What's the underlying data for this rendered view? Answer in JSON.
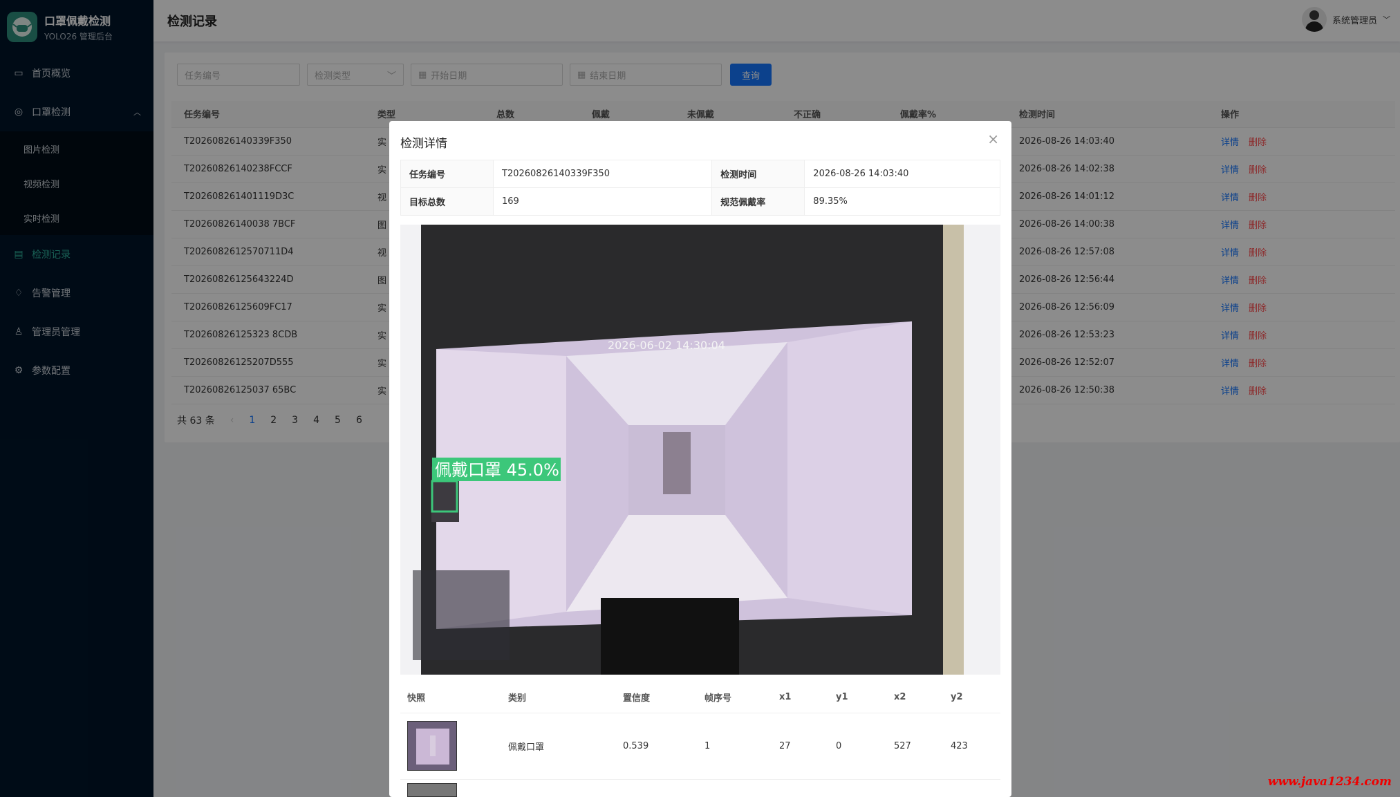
{
  "app": {
    "title": "口罩佩戴检测",
    "subtitle": "YOLO26 管理后台"
  },
  "sidebar": {
    "items": [
      {
        "label": "首页概览",
        "icon": "monitor-icon"
      },
      {
        "label": "口罩检测",
        "icon": "camera-icon"
      },
      {
        "label": "检测记录",
        "icon": "document-icon"
      },
      {
        "label": "告警管理",
        "icon": "bell-icon"
      },
      {
        "label": "管理员管理",
        "icon": "user-icon"
      },
      {
        "label": "参数配置",
        "icon": "gear-icon"
      }
    ],
    "sub_items": [
      "图片检测",
      "视频检测",
      "实时检测"
    ]
  },
  "header": {
    "title": "检测记录",
    "user": "系统管理员"
  },
  "filters": {
    "task_placeholder": "任务编号",
    "type_placeholder": "检测类型",
    "start_placeholder": "开始日期",
    "end_placeholder": "结束日期",
    "query": "查询"
  },
  "table": {
    "headers": [
      "任务编号",
      "类型",
      "总数",
      "佩戴",
      "未佩戴",
      "不正确",
      "佩戴率%",
      "检测时间",
      "操作"
    ],
    "detail": "详情",
    "delete": "删除",
    "rows": [
      {
        "id": "T20260826140339F350",
        "type": "实",
        "time": "2026-08-26 14:03:40"
      },
      {
        "id": "T20260826140238FCCF",
        "type": "实",
        "time": "2026-08-26 14:02:38"
      },
      {
        "id": "T202608261401119D3C",
        "type": "视",
        "time": "2026-08-26 14:01:12"
      },
      {
        "id": "T20260826140038 7BCF",
        "type": "图",
        "time": "2026-08-26 14:00:38"
      },
      {
        "id": "T2026082612570711D4",
        "type": "视",
        "time": "2026-08-26 12:57:08"
      },
      {
        "id": "T20260826125643224D",
        "type": "图",
        "time": "2026-08-26 12:56:44"
      },
      {
        "id": "T20260826125609FC17",
        "type": "实",
        "time": "2026-08-26 12:56:09"
      },
      {
        "id": "T20260826125323 8CDB",
        "type": "实",
        "time": "2026-08-26 12:53:23"
      },
      {
        "id": "T20260826125207D555",
        "type": "实",
        "time": "2026-08-26 12:52:07"
      },
      {
        "id": "T20260826125037 65BC",
        "type": "实",
        "time": "2026-08-26 12:50:38"
      }
    ]
  },
  "pagination": {
    "total": "共 63 条",
    "pages": [
      "1",
      "2",
      "3",
      "4",
      "5",
      "6"
    ],
    "current": "1"
  },
  "modal": {
    "title": "检测详情",
    "labels": {
      "task": "任务编号",
      "time": "检测时间",
      "total": "目标总数",
      "rate": "规范佩戴率"
    },
    "values": {
      "task": "T20260826140339F350",
      "time": "2026-08-26 14:03:40",
      "total": "169",
      "rate": "89.35%"
    },
    "photo": {
      "timestamp": "2026-06-02 14:30:04",
      "box_label": "佩戴口罩 45.0%"
    },
    "detail_headers": [
      "快照",
      "类别",
      "置信度",
      "帧序号",
      "x1",
      "y1",
      "x2",
      "y2"
    ],
    "detail_row": {
      "category": "佩戴口罩",
      "confidence": "0.539",
      "frame": "1",
      "x1": "27",
      "y1": "0",
      "x2": "527",
      "y2": "423"
    }
  },
  "watermark": "www.java1234.com"
}
